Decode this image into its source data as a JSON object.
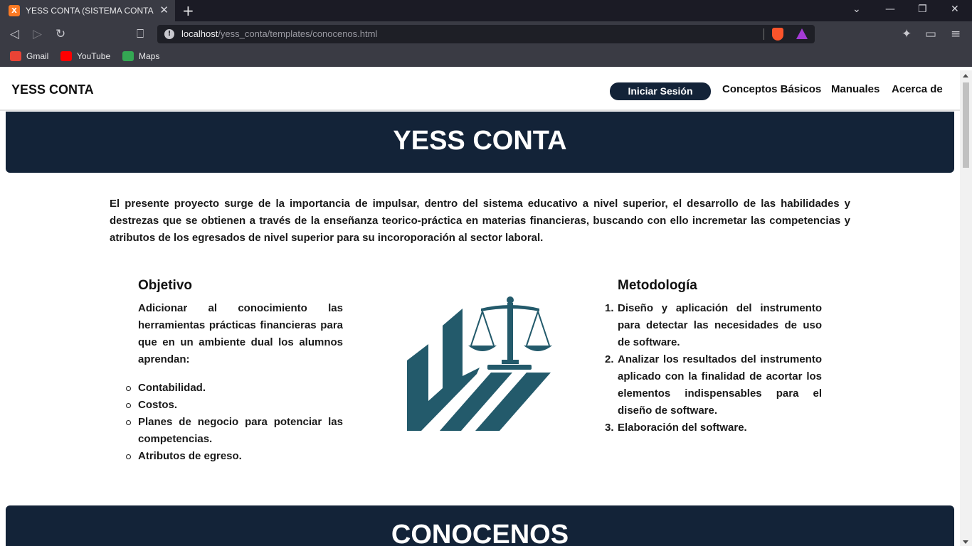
{
  "browser": {
    "tab_title": "YESS CONTA (SISTEMA CONTABLE",
    "tab_favicon": "X",
    "url_host": "localhost",
    "url_path": "/yess_conta/templates/conocenos.html",
    "bookmarks": [
      {
        "label": "Gmail",
        "color": "#ea4335"
      },
      {
        "label": "YouTube",
        "color": "#ff0000"
      },
      {
        "label": "Maps",
        "color": "#34a853"
      }
    ]
  },
  "nav": {
    "brand": "YESS CONTA",
    "login": "Iniciar Sesión",
    "links": [
      "Conceptos Básicos",
      "Manuales",
      "Acerca de"
    ]
  },
  "hero": {
    "title": "YESS CONTA"
  },
  "intro": "El presente proyecto surge de la importancia de impulsar, dentro del sistema educativo a nivel superior, el desarrollo de las habilidades y destrezas que se obtienen a través de la enseñanza teorico-práctica en materias financieras, buscando con ello incremetar las competencias y atributos de los egresados de nivel superior para su incoroporación al sector laboral.",
  "objetivo": {
    "heading": "Objetivo",
    "text": "Adicionar al conocimiento las herramientas prácticas financieras para que en un ambiente dual los alumnos aprendan:",
    "items": [
      "Contabilidad.",
      "Costos.",
      "Planes de negocio para potenciar las competencias.",
      "Atributos de egreso."
    ]
  },
  "metodologia": {
    "heading": "Metodología",
    "items": [
      "Diseño y aplicación del instrumento para detectar las necesidades de uso de software.",
      "Analizar los resultados del instrumento aplicado con la finalidad de acortar los elementos indispensables para el diseño de software.",
      "Elaboración del software."
    ]
  },
  "section2": {
    "title": "CONOCENOS"
  },
  "colors": {
    "navy": "#132338",
    "logo_teal": "#235a6b"
  }
}
